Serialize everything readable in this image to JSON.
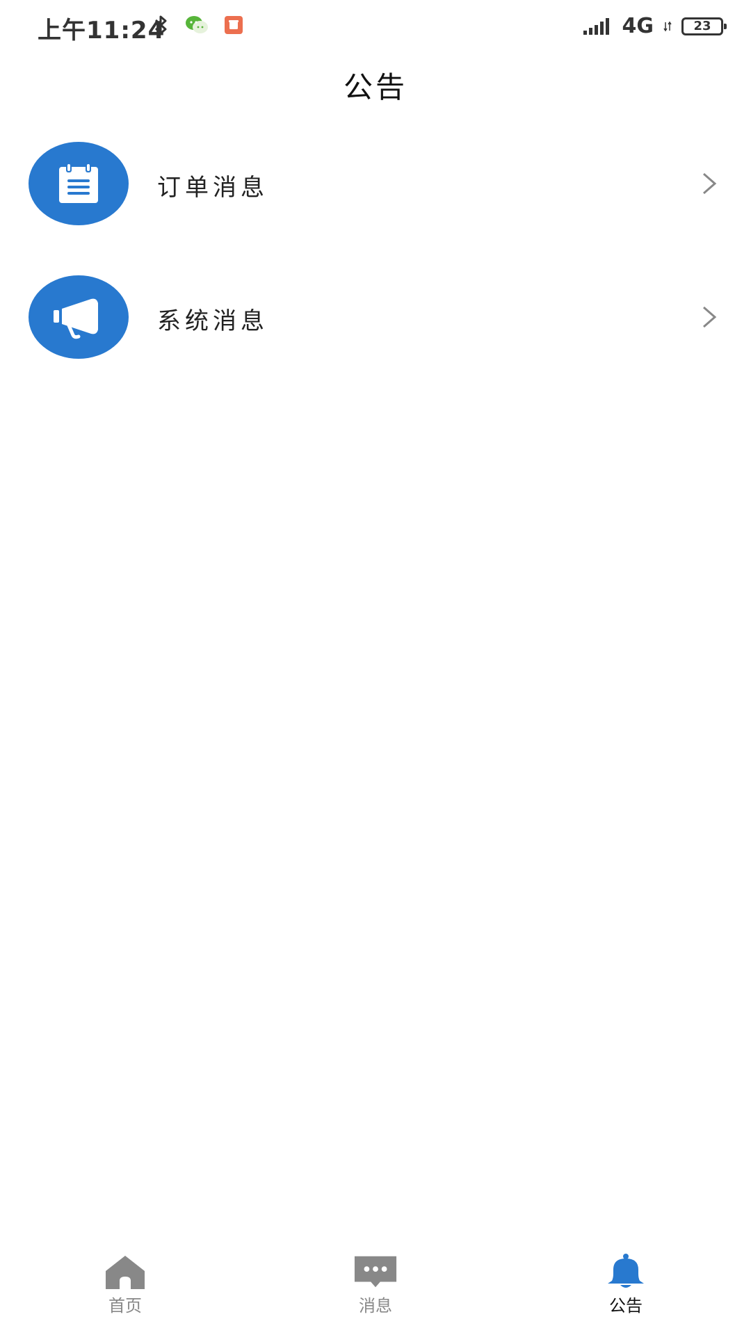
{
  "status_bar": {
    "time": "上午11:24",
    "network": "4G",
    "battery": "23"
  },
  "header": {
    "title": "公告"
  },
  "list": {
    "items": [
      {
        "label": "订单消息",
        "icon": "clipboard-icon"
      },
      {
        "label": "系统消息",
        "icon": "megaphone-icon"
      }
    ]
  },
  "bottom_nav": {
    "items": [
      {
        "label": "首页",
        "icon": "home-icon",
        "active": false
      },
      {
        "label": "消息",
        "icon": "chat-bubble-icon",
        "active": false
      },
      {
        "label": "公告",
        "icon": "bell-icon",
        "active": true
      }
    ]
  },
  "colors": {
    "accent": "#2879cf",
    "inactive": "#888888"
  }
}
